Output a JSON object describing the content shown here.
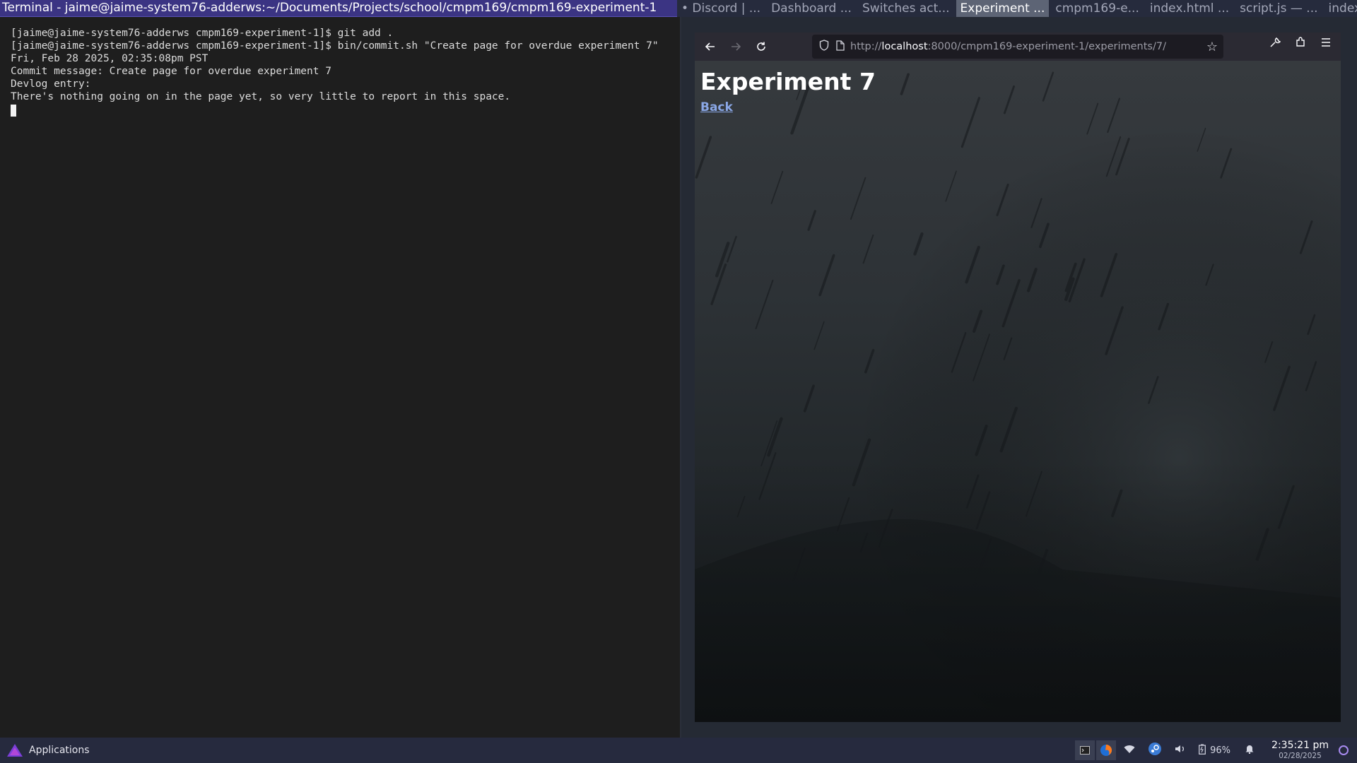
{
  "topbar": {
    "terminal_title": "Terminal - jaime@jaime-system76-adderws:~/Documents/Projects/school/cmpm169/cmpm169-experiment-1",
    "tabs": [
      {
        "label": "• Discord | ..."
      },
      {
        "label": "Dashboard ..."
      },
      {
        "label": "Switches act..."
      },
      {
        "label": "Experiment ..."
      },
      {
        "label": "cmpm169-e..."
      },
      {
        "label": "index.html ..."
      },
      {
        "label": "script.js — ..."
      },
      {
        "label": "index.html ..."
      }
    ]
  },
  "terminal": {
    "lines": [
      "[jaime@jaime-system76-adderws cmpm169-experiment-1]$ git add .",
      "[jaime@jaime-system76-adderws cmpm169-experiment-1]$ bin/commit.sh \"Create page for overdue experiment 7\"",
      "Fri, Feb 28 2025, 02:35:08pm PST",
      "Commit message: Create page for overdue experiment 7",
      "Devlog entry:",
      "There's nothing going on in the page yet, so very little to report in this space."
    ]
  },
  "browser": {
    "url_prefix": "http://",
    "url_host": "localhost",
    "url_rest": ":8000/cmpm169-experiment-1/experiments/7/",
    "icons": {
      "back": "back-arrow-icon",
      "forward": "forward-arrow-icon",
      "reload": "reload-icon",
      "shield": "shield-icon",
      "page": "page-icon",
      "star": "star-icon",
      "tools": "wrench-icon",
      "extensions": "extensions-icon",
      "menu": "hamburger-menu-icon"
    },
    "page": {
      "heading": "Experiment 7",
      "back_link": "Back"
    }
  },
  "taskbar": {
    "apps_label": "Applications",
    "battery": "96%",
    "time": "2:35:21 pm",
    "date": "02/28/2025"
  },
  "colors": {
    "terminal_bg": "#1e1e1e",
    "title_bar": "#3b3483",
    "taskbar": "#262a3e",
    "link": "#8aa7e6"
  }
}
